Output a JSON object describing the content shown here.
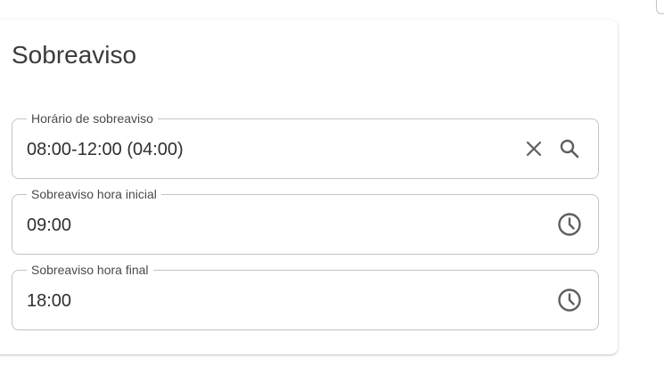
{
  "section": {
    "title": "Sobreaviso"
  },
  "fields": [
    {
      "label": "Horário de sobreaviso",
      "value": "08:00-12:00 (04:00)",
      "icons": [
        "close-icon",
        "search-icon"
      ]
    },
    {
      "label": "Sobreaviso hora inicial",
      "value": "09:00",
      "icons": [
        "clock-icon"
      ]
    },
    {
      "label": "Sobreaviso hora final",
      "value": "18:00",
      "icons": [
        "clock-icon"
      ]
    }
  ],
  "colors": {
    "border": "#c4c4c4",
    "text": "#2f2f2f",
    "label": "#4a4a4a",
    "icon": "#5f5f5f"
  }
}
